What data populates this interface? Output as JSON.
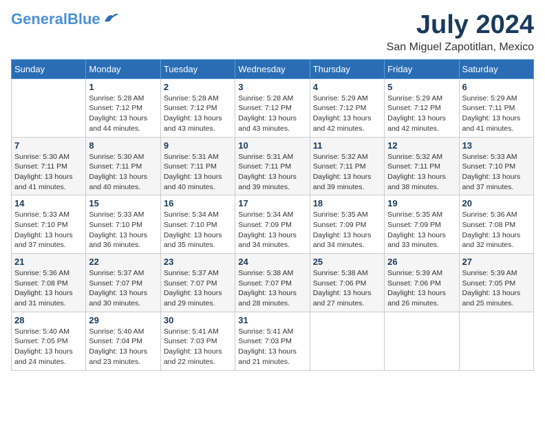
{
  "header": {
    "logo_general": "General",
    "logo_blue": "Blue",
    "main_title": "July 2024",
    "subtitle": "San Miguel Zapotitlan, Mexico"
  },
  "days_of_week": [
    "Sunday",
    "Monday",
    "Tuesday",
    "Wednesday",
    "Thursday",
    "Friday",
    "Saturday"
  ],
  "weeks": [
    [
      {
        "day": "",
        "info": ""
      },
      {
        "day": "1",
        "info": "Sunrise: 5:28 AM\nSunset: 7:12 PM\nDaylight: 13 hours\nand 44 minutes."
      },
      {
        "day": "2",
        "info": "Sunrise: 5:28 AM\nSunset: 7:12 PM\nDaylight: 13 hours\nand 43 minutes."
      },
      {
        "day": "3",
        "info": "Sunrise: 5:28 AM\nSunset: 7:12 PM\nDaylight: 13 hours\nand 43 minutes."
      },
      {
        "day": "4",
        "info": "Sunrise: 5:29 AM\nSunset: 7:12 PM\nDaylight: 13 hours\nand 42 minutes."
      },
      {
        "day": "5",
        "info": "Sunrise: 5:29 AM\nSunset: 7:12 PM\nDaylight: 13 hours\nand 42 minutes."
      },
      {
        "day": "6",
        "info": "Sunrise: 5:29 AM\nSunset: 7:11 PM\nDaylight: 13 hours\nand 41 minutes."
      }
    ],
    [
      {
        "day": "7",
        "info": "Sunrise: 5:30 AM\nSunset: 7:11 PM\nDaylight: 13 hours\nand 41 minutes."
      },
      {
        "day": "8",
        "info": "Sunrise: 5:30 AM\nSunset: 7:11 PM\nDaylight: 13 hours\nand 40 minutes."
      },
      {
        "day": "9",
        "info": "Sunrise: 5:31 AM\nSunset: 7:11 PM\nDaylight: 13 hours\nand 40 minutes."
      },
      {
        "day": "10",
        "info": "Sunrise: 5:31 AM\nSunset: 7:11 PM\nDaylight: 13 hours\nand 39 minutes."
      },
      {
        "day": "11",
        "info": "Sunrise: 5:32 AM\nSunset: 7:11 PM\nDaylight: 13 hours\nand 39 minutes."
      },
      {
        "day": "12",
        "info": "Sunrise: 5:32 AM\nSunset: 7:11 PM\nDaylight: 13 hours\nand 38 minutes."
      },
      {
        "day": "13",
        "info": "Sunrise: 5:33 AM\nSunset: 7:10 PM\nDaylight: 13 hours\nand 37 minutes."
      }
    ],
    [
      {
        "day": "14",
        "info": "Sunrise: 5:33 AM\nSunset: 7:10 PM\nDaylight: 13 hours\nand 37 minutes."
      },
      {
        "day": "15",
        "info": "Sunrise: 5:33 AM\nSunset: 7:10 PM\nDaylight: 13 hours\nand 36 minutes."
      },
      {
        "day": "16",
        "info": "Sunrise: 5:34 AM\nSunset: 7:10 PM\nDaylight: 13 hours\nand 35 minutes."
      },
      {
        "day": "17",
        "info": "Sunrise: 5:34 AM\nSunset: 7:09 PM\nDaylight: 13 hours\nand 34 minutes."
      },
      {
        "day": "18",
        "info": "Sunrise: 5:35 AM\nSunset: 7:09 PM\nDaylight: 13 hours\nand 34 minutes."
      },
      {
        "day": "19",
        "info": "Sunrise: 5:35 AM\nSunset: 7:09 PM\nDaylight: 13 hours\nand 33 minutes."
      },
      {
        "day": "20",
        "info": "Sunrise: 5:36 AM\nSunset: 7:08 PM\nDaylight: 13 hours\nand 32 minutes."
      }
    ],
    [
      {
        "day": "21",
        "info": "Sunrise: 5:36 AM\nSunset: 7:08 PM\nDaylight: 13 hours\nand 31 minutes."
      },
      {
        "day": "22",
        "info": "Sunrise: 5:37 AM\nSunset: 7:07 PM\nDaylight: 13 hours\nand 30 minutes."
      },
      {
        "day": "23",
        "info": "Sunrise: 5:37 AM\nSunset: 7:07 PM\nDaylight: 13 hours\nand 29 minutes."
      },
      {
        "day": "24",
        "info": "Sunrise: 5:38 AM\nSunset: 7:07 PM\nDaylight: 13 hours\nand 28 minutes."
      },
      {
        "day": "25",
        "info": "Sunrise: 5:38 AM\nSunset: 7:06 PM\nDaylight: 13 hours\nand 27 minutes."
      },
      {
        "day": "26",
        "info": "Sunrise: 5:39 AM\nSunset: 7:06 PM\nDaylight: 13 hours\nand 26 minutes."
      },
      {
        "day": "27",
        "info": "Sunrise: 5:39 AM\nSunset: 7:05 PM\nDaylight: 13 hours\nand 25 minutes."
      }
    ],
    [
      {
        "day": "28",
        "info": "Sunrise: 5:40 AM\nSunset: 7:05 PM\nDaylight: 13 hours\nand 24 minutes."
      },
      {
        "day": "29",
        "info": "Sunrise: 5:40 AM\nSunset: 7:04 PM\nDaylight: 13 hours\nand 23 minutes."
      },
      {
        "day": "30",
        "info": "Sunrise: 5:41 AM\nSunset: 7:03 PM\nDaylight: 13 hours\nand 22 minutes."
      },
      {
        "day": "31",
        "info": "Sunrise: 5:41 AM\nSunset: 7:03 PM\nDaylight: 13 hours\nand 21 minutes."
      },
      {
        "day": "",
        "info": ""
      },
      {
        "day": "",
        "info": ""
      },
      {
        "day": "",
        "info": ""
      }
    ]
  ]
}
